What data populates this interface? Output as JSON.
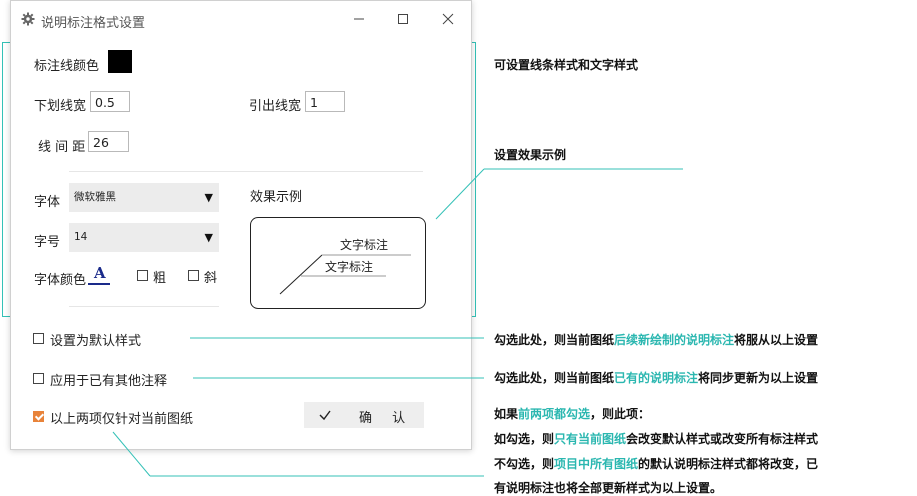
{
  "dialog": {
    "title": "说明标注格式设置",
    "minimize_icon": "minimize-icon",
    "maximize_icon": "maximize-icon",
    "close_icon": "close-icon",
    "line_color_label": "标注线颜色",
    "line_color": "#000000",
    "underline_width_label": "下划线宽",
    "underline_width_value": "0.5",
    "leader_width_label": "引出线宽",
    "leader_width_value": "1",
    "line_spacing_label": "线 间 距",
    "line_spacing_value": "26",
    "font_label": "字体",
    "font_value": "微软雅黑",
    "size_label": "字号",
    "size_value": "14",
    "font_color_label": "字体颜色",
    "font_color_glyph": "A",
    "font_color": "#1a2a8a",
    "bold_label": "粗",
    "italic_label": "斜",
    "preview_title": "效果示例",
    "preview_text_1": "文字标注",
    "preview_text_2": "文字标注",
    "default_style_label": "设置为默认样式",
    "default_style_checked": false,
    "apply_existing_label": "应用于已有其他注释",
    "apply_existing_checked": false,
    "current_drawing_label": "以上两项仅针对当前图纸",
    "current_drawing_checked": true,
    "confirm_label": "确 认",
    "accent": "#e8833a"
  },
  "annotations": {
    "a1": "可设置线条样式和文字样式",
    "a2": "设置效果示例",
    "a3_pre": "勾选此处，则当前图纸",
    "a3_hl": "后续新绘制的说明标注",
    "a3_post": "将服从以上设置",
    "a4_pre": "勾选此处，则当前图纸",
    "a4_hl": "已有的说明标注",
    "a4_post": "将同步更新为以上设置",
    "a5_l1_pre": "如果",
    "a5_l1_hl": "前两项都勾选",
    "a5_l1_post": "，则此项：",
    "a5_l2_pre": "如勾选，则",
    "a5_l2_hl": "只有当前图纸",
    "a5_l2_post": "会改变默认样式或改变所有标注样式",
    "a5_l3_pre": "不勾选，则",
    "a5_l3_hl": "项目中所有图纸",
    "a5_l3_post": "的默认说明标注样式都将改变，已",
    "a5_l4": "有说明标注也将全部更新样式为以上设置。",
    "teal": "#2bb7b0"
  }
}
